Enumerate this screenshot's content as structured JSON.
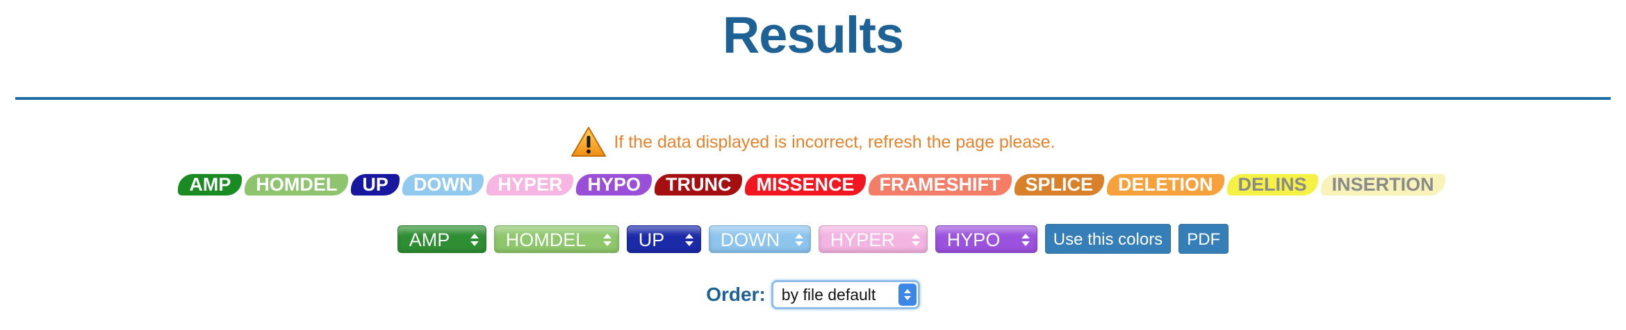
{
  "header": {
    "title": "Results"
  },
  "warning": {
    "icon": "warning-icon",
    "text": "If the data displayed is incorrect, refresh the page please."
  },
  "legend": [
    {
      "label": "AMP",
      "color": "#1a8a22",
      "text_color": "#ffffff"
    },
    {
      "label": "HOMDEL",
      "color": "#8fc46f",
      "text_color": "#ffffff"
    },
    {
      "label": "UP",
      "color": "#1717a0",
      "text_color": "#ffffff"
    },
    {
      "label": "DOWN",
      "color": "#92c9ef",
      "text_color": "#ffffff"
    },
    {
      "label": "HYPER",
      "color": "#f6b6e1",
      "text_color": "#ffffff"
    },
    {
      "label": "HYPO",
      "color": "#9a4fd8",
      "text_color": "#ffffff"
    },
    {
      "label": "TRUNC",
      "color": "#a50f12",
      "text_color": "#ffffff"
    },
    {
      "label": "MISSENCE",
      "color": "#f21621",
      "text_color": "#ffffff"
    },
    {
      "label": "FRAMESHIFT",
      "color": "#f47d67",
      "text_color": "#ffffff"
    },
    {
      "label": "SPLICE",
      "color": "#d8812a",
      "text_color": "#ffffff"
    },
    {
      "label": "DELETION",
      "color": "#f6a13c",
      "text_color": "#ffffff"
    },
    {
      "label": "DELINS",
      "color": "#f5f245",
      "text_color": "#8a8a8a"
    },
    {
      "label": "INSERTION",
      "color": "#f8f3b8",
      "text_color": "#8a8a8a"
    }
  ],
  "color_selects": [
    {
      "label": "AMP",
      "color": "#2e8e32"
    },
    {
      "label": "HOMDEL",
      "color": "#8ec76c"
    },
    {
      "label": "UP",
      "color": "#1b2aa8"
    },
    {
      "label": "DOWN",
      "color": "#8dc5ee"
    },
    {
      "label": "HYPER",
      "color": "#f3b4e1"
    },
    {
      "label": "HYPO",
      "color": "#9b52de"
    }
  ],
  "buttons": {
    "use_colors": "Use this colors",
    "pdf": "PDF"
  },
  "order": {
    "label": "Order:",
    "selected": "by file default"
  }
}
